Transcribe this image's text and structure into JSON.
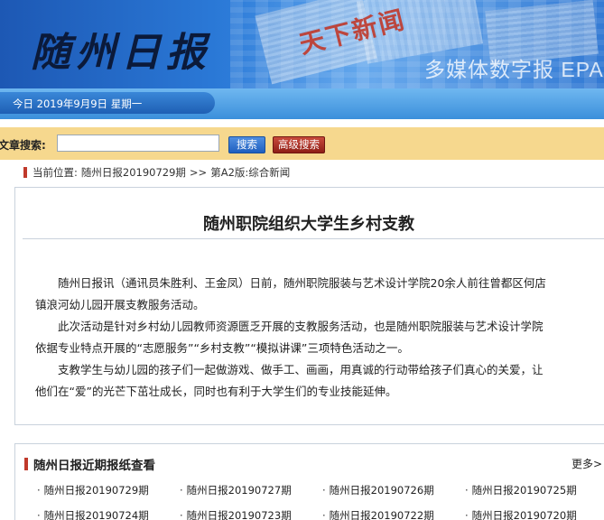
{
  "header": {
    "logo_text": "随州日报",
    "slogan": "多媒体数字报 EPA",
    "collage_headline": "天下新闻"
  },
  "datebar": {
    "date_text": "今日   2019年9月9日  星期一"
  },
  "search": {
    "label": "文章搜索:",
    "input_value": "",
    "placeholder": "",
    "search_button": "搜索",
    "advanced_button": "高级搜索"
  },
  "breadcrumb": {
    "prefix": "当前位置:",
    "issue": "随州日报20190729期",
    "separator": ">>",
    "section": "第A2版:综合新闻"
  },
  "article": {
    "title": "随州职院组织大学生乡村支教",
    "paragraphs": [
      "随州日报讯（通讯员朱胜利、王金凤）日前，随州职院服装与艺术设计学院20余人前往曾都区何店",
      "镇浪河幼儿园开展支教服务活动。",
      "此次活动是针对乡村幼儿园教师资源匮乏开展的支教服务活动，也是随州职院服装与艺术设计学院",
      "依据专业特点开展的“志愿服务”“乡村支教”“模拟讲课”三项特色活动之一。",
      "支教学生与幼儿园的孩子们一起做游戏、做手工、画画，用真诚的行动带给孩子们真心的关爱，让",
      "他们在“爱”的光芒下茁壮成长，同时也有利于大学生们的专业技能延伸。"
    ]
  },
  "recent": {
    "title": "随州日报近期报纸查看",
    "more": "更多>",
    "items": [
      "随州日报20190729期",
      "随州日报20190727期",
      "随州日报20190726期",
      "随州日报20190725期",
      "随州日报20190724期",
      "随州日报20190723期",
      "随州日报20190722期",
      "随州日报20190720期"
    ]
  }
}
